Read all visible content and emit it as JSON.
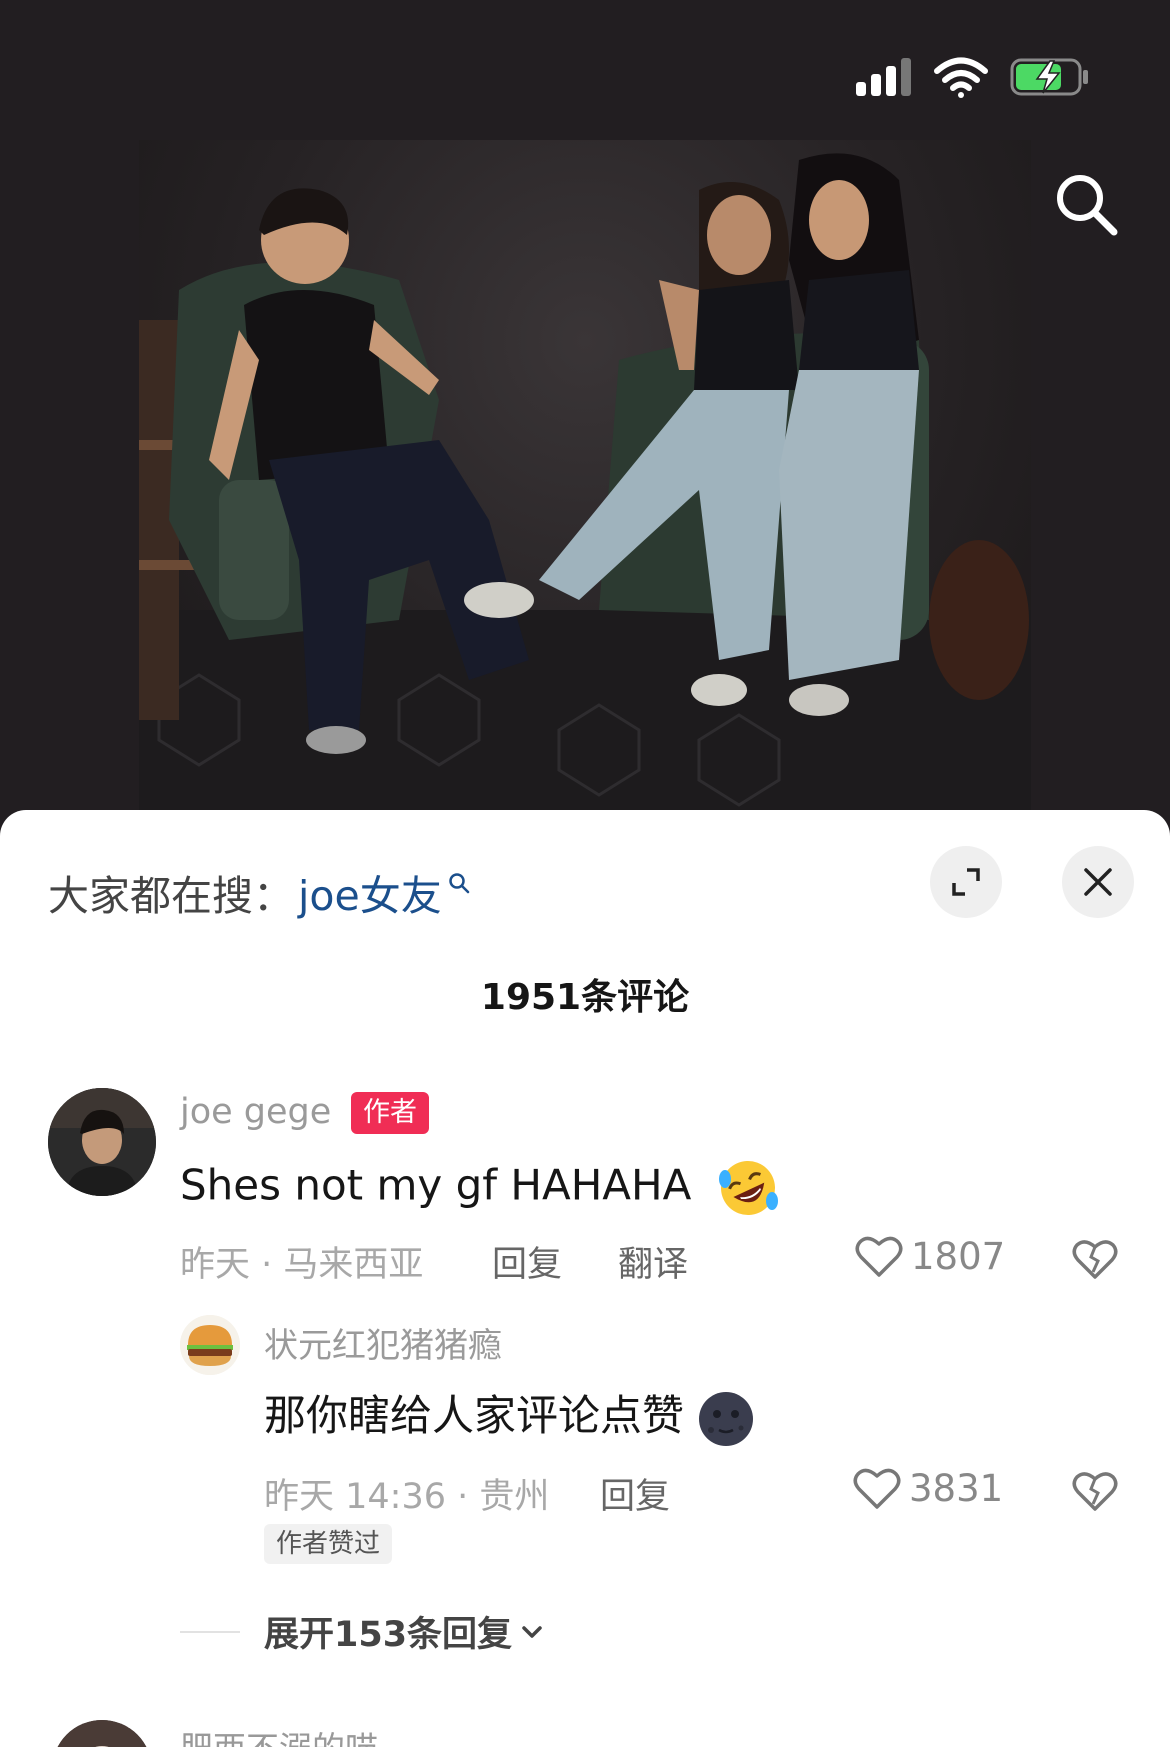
{
  "hot_search": {
    "prefix": "大家都在搜：",
    "term": "joe女友"
  },
  "comments_header": {
    "count_label": "1951条评论"
  },
  "comments": [
    {
      "username": "joe gege",
      "badge": "作者",
      "text": "Shes not my gf HAHAHA",
      "emoji": "rolling-on-floor-laughing",
      "meta": "昨天 · 马来西亚",
      "reply_label": "回复",
      "translate_label": "翻译",
      "likes": "1807"
    }
  ],
  "replies": [
    {
      "username": "状元红犯猪猪瘾",
      "text": "那你瞎给人家评论点赞",
      "emoji": "new-moon-face",
      "meta": "昨天 14:36 · 贵州",
      "reply_label": "回复",
      "likes": "3831",
      "tag": "作者赞过"
    }
  ],
  "expand_replies": {
    "label": "展开153条回复"
  },
  "next_comment": {
    "username": "肥西不溺的喵"
  },
  "colors": {
    "accent_link": "#1b4f8c",
    "author_badge": "#f02d55",
    "battery_green": "#4cd964"
  },
  "icons": [
    "signal-icon",
    "wifi-icon",
    "battery-charging-icon",
    "search-icon",
    "expand-icon",
    "close-icon",
    "heart-icon",
    "dislike-heart-icon",
    "chevron-down-icon"
  ]
}
